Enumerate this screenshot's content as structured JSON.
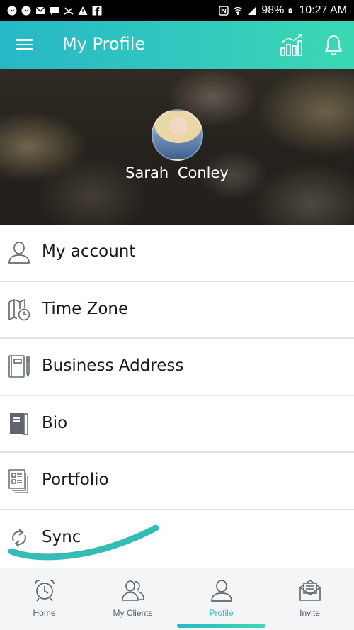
{
  "status_bar": {
    "battery": "98%",
    "time": "10:27 AM",
    "left_icons": [
      "messenger-icon",
      "messenger-icon",
      "mail-icon",
      "chat-icon",
      "missed-call-icon",
      "warning-icon",
      "facebook-icon"
    ],
    "right_icons": [
      "nfc-icon",
      "wifi-icon",
      "signal-icon",
      "battery-icon"
    ]
  },
  "header": {
    "title": "My Profile",
    "icons": [
      "menu-icon",
      "stats-chart-icon",
      "bell-icon"
    ],
    "accent_start": "#27b8c6",
    "accent_end": "#3bd9b3"
  },
  "profile": {
    "name": "Sarah  Conley"
  },
  "menu": {
    "items": [
      {
        "label": "My account",
        "icon": "user-icon"
      },
      {
        "label": "Time Zone",
        "icon": "map-clock-icon"
      },
      {
        "label": "Business Address",
        "icon": "notebook-pen-icon"
      },
      {
        "label": "Bio",
        "icon": "book-icon"
      },
      {
        "label": "Portfolio",
        "icon": "portfolio-icon"
      },
      {
        "label": "Sync",
        "icon": "sync-icon"
      }
    ]
  },
  "bottom_nav": {
    "items": [
      {
        "label": "Home",
        "icon": "alarm-clock-icon"
      },
      {
        "label": "My Clients",
        "icon": "clients-icon"
      },
      {
        "label": "Profile",
        "icon": "profile-icon",
        "active": true
      },
      {
        "label": "Invite",
        "icon": "envelope-icon"
      }
    ],
    "active_color": "#2bb8c6"
  }
}
